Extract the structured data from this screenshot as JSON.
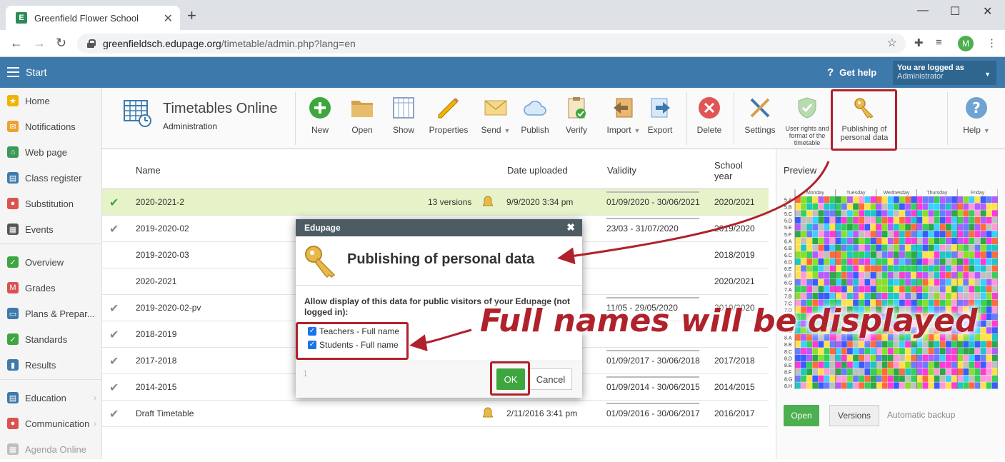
{
  "browser": {
    "tab_title": "Greenfield Flower School",
    "favicon_letter": "E",
    "url_domain": "greenfieldsch.edupage.org",
    "url_path": "/timetable/admin.php?lang=en",
    "avatar_letter": "M"
  },
  "appbar": {
    "start": "Start",
    "get_help": "Get help",
    "logged_as": "You are logged as",
    "user": "Administrator"
  },
  "sidebar": {
    "items": [
      {
        "label": "Home",
        "icon": "star-icon",
        "color": "#f0b400"
      },
      {
        "label": "Notifications",
        "icon": "mail-icon",
        "color": "#f0a030"
      },
      {
        "label": "Web page",
        "icon": "home-icon",
        "color": "#3a9a55"
      },
      {
        "label": "Class register",
        "icon": "book-icon",
        "color": "#3d7aab"
      },
      {
        "label": "Substitution",
        "icon": "person-icon",
        "color": "#d9534f"
      },
      {
        "label": "Events",
        "icon": "calendar-icon",
        "color": "#555555"
      },
      {
        "label": "Overview",
        "icon": "check-circle-icon",
        "color": "#3ea63e"
      },
      {
        "label": "Grades",
        "icon": "grade-icon",
        "color": "#d9534f"
      },
      {
        "label": "Plans & Prepar...",
        "icon": "plans-icon",
        "color": "#3d7aab"
      },
      {
        "label": "Standards",
        "icon": "shield-icon",
        "color": "#3ea63e"
      },
      {
        "label": "Results",
        "icon": "bar-chart-icon",
        "color": "#3d7aab"
      },
      {
        "label": "Education",
        "icon": "education-icon",
        "color": "#3d7aab"
      },
      {
        "label": "Communication",
        "icon": "chat-icon",
        "color": "#d9534f"
      },
      {
        "label": "Agenda Online",
        "icon": "agenda-icon",
        "color": "#888888"
      }
    ]
  },
  "toolbar": {
    "title": "Timetables Online",
    "subtitle": "Administration",
    "buttons": {
      "new": "New",
      "open": "Open",
      "show": "Show",
      "properties": "Properties",
      "send": "Send",
      "publish": "Publish",
      "verify": "Verify",
      "import": "Import",
      "export": "Export",
      "delete": "Delete",
      "settings": "Settings",
      "user_rights": "User rights and format of the timetable",
      "publishing": "Publishing of personal data",
      "help": "Help"
    }
  },
  "table": {
    "headers": {
      "name": "Name",
      "date_uploaded": "Date uploaded",
      "validity": "Validity",
      "school_year": "School year"
    },
    "rows": [
      {
        "name": "2020-2021-2",
        "versions": "13 versions",
        "date": "9/9/2020 3:34 pm",
        "validity": "01/09/2020 - 30/06/2021",
        "year": "2020/2021",
        "check": "green",
        "lock": true,
        "selected": true
      },
      {
        "name": "2019-2020-02",
        "versions": "",
        "date": "",
        "validity": "23/03 - 31/07/2020",
        "year": "2019/2020",
        "check": "gray",
        "lock": false,
        "selected": false
      },
      {
        "name": "2019-2020-03",
        "versions": "",
        "date": "",
        "validity": "",
        "year": "2018/2019",
        "check": "none",
        "lock": false,
        "selected": false
      },
      {
        "name": "2020-2021",
        "versions": "",
        "date": "",
        "validity": "",
        "year": "2020/2021",
        "check": "none",
        "lock": false,
        "selected": false
      },
      {
        "name": "2019-2020-02-pv",
        "versions": "",
        "date": "",
        "validity": "11/05 - 29/05/2020",
        "year": "2019/2020",
        "check": "gray",
        "lock": false,
        "selected": false
      },
      {
        "name": "2018-2019",
        "versions": "",
        "date": "",
        "validity": "",
        "year": "",
        "check": "gray",
        "lock": false,
        "selected": false
      },
      {
        "name": "2017-2018",
        "versions": "",
        "date": "",
        "validity": "01/09/2017 - 30/06/2018",
        "year": "2017/2018",
        "check": "gray",
        "lock": false,
        "selected": false
      },
      {
        "name": "2014-2015",
        "versions": "",
        "date": "",
        "validity": "01/09/2014 - 30/06/2015",
        "year": "2014/2015",
        "check": "gray",
        "lock": false,
        "selected": false
      },
      {
        "name": "Draft Timetable",
        "versions": "",
        "date": "2/11/2016 3:41 pm",
        "validity": "01/09/2016 - 30/06/2017",
        "year": "2016/2017",
        "check": "gray",
        "lock": true,
        "selected": false
      }
    ]
  },
  "preview": {
    "label": "Preview",
    "days": [
      "Monday",
      "Tuesday",
      "Wednesday",
      "Thursday",
      "Friday"
    ],
    "classes": [
      "5.A",
      "5.B",
      "5.C",
      "5.D",
      "5.E",
      "5.F",
      "6.A",
      "6.B",
      "6.C",
      "6.D",
      "6.E",
      "6.F",
      "6.G",
      "7.A",
      "7.B",
      "7.C",
      "7.D",
      "7.E",
      "7.F",
      "7.G",
      "8.A",
      "8.B",
      "8.C",
      "8.D",
      "8.E",
      "8.F",
      "8.G",
      "8.H"
    ],
    "open": "Open",
    "versions": "Versions",
    "automatic_backup": "Automatic backup"
  },
  "modal": {
    "header": "Edupage",
    "title": "Publishing of personal data",
    "text": "Allow display of this data for public visitors of your Edupage (not logged in):",
    "teachers": "Teachers - Full name",
    "students": "Students - Full name",
    "footer_num": "1",
    "ok": "OK",
    "cancel": "Cancel"
  },
  "annotation": {
    "text": "Full names will be displayed",
    "color": "#b0222b"
  }
}
